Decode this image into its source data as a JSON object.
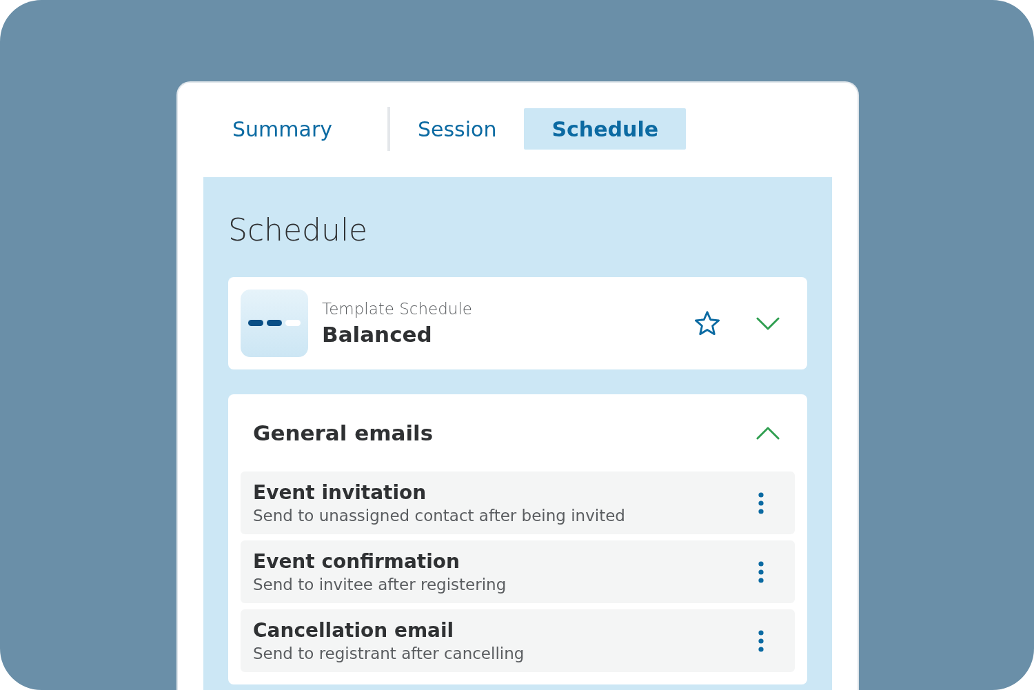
{
  "tabs": [
    {
      "label": "Summary",
      "selected": false
    },
    {
      "label": "Session",
      "selected": false
    },
    {
      "label": "Schedule",
      "selected": true
    }
  ],
  "panel": {
    "title": "Schedule"
  },
  "template": {
    "label": "Template Schedule",
    "name": "Balanced",
    "starred": false,
    "expanded": false
  },
  "section": {
    "title": "General emails",
    "expanded": true,
    "emails": [
      {
        "title": "Event invitation",
        "description": "Send to unassigned contact after being invited"
      },
      {
        "title": "Event confirmation",
        "description": "Send to invitee after registering"
      },
      {
        "title": "Cancellation email",
        "description": "Send to registrant after cancelling"
      }
    ]
  }
}
